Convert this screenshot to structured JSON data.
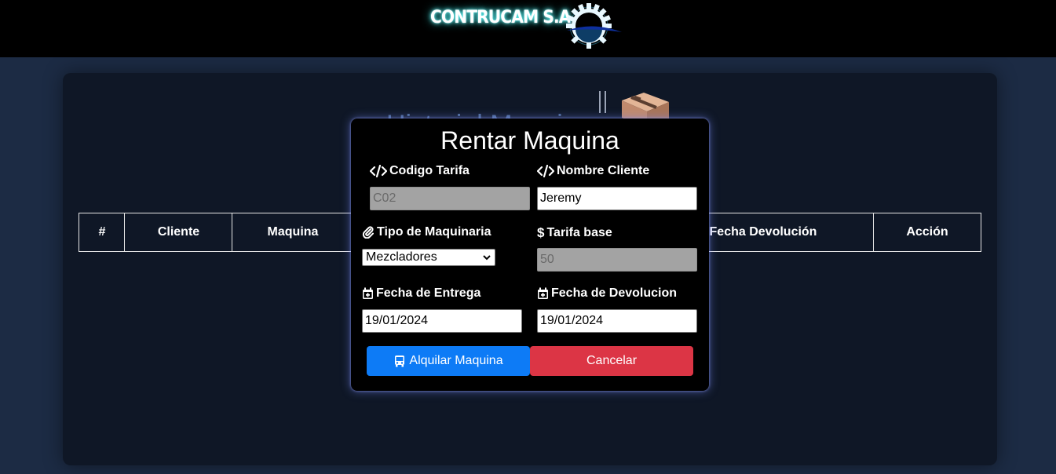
{
  "header": {
    "brand": "CONTRUCAM S.A"
  },
  "page": {
    "title": "Historial Maquinas",
    "table": {
      "columns": [
        "#",
        "Cliente",
        "Maquina",
        "Fecha Devolución",
        "Acción"
      ]
    }
  },
  "modal": {
    "title": "Rentar Maquina",
    "fields": {
      "codigo_tarifa": {
        "label": "Codigo Tarifa",
        "value": "C02"
      },
      "nombre_cliente": {
        "label": "Nombre Cliente",
        "value": "Jeremy"
      },
      "tipo_maquinaria": {
        "label": "Tipo de Maquinaria",
        "selected": "Mezcladores"
      },
      "tarifa_base": {
        "label": "Tarifa base",
        "value": "50"
      },
      "fecha_entrega": {
        "label": "Fecha de Entrega",
        "value": "19/01/2024"
      },
      "fecha_devolucion": {
        "label": "Fecha de Devolucion",
        "value": "19/01/2024"
      }
    },
    "buttons": {
      "primary": "Alquilar Maquina",
      "cancel": "Cancelar"
    }
  },
  "icons": {
    "code": "code-icon",
    "paperclip": "paperclip-icon",
    "dollar": "dollar-icon",
    "calendar": "calendar-plus-icon",
    "truck": "truck-icon",
    "gear": "gear-logo-icon",
    "box": "box-icon"
  },
  "colors": {
    "header_bg": "#000000",
    "page_bg": "#1c2b44",
    "card_bg": "#0f1726",
    "modal_bg": "#000000",
    "primary": "#0d7bf6",
    "danger": "#dc3545",
    "disabled_input": "#a3a3a3"
  }
}
